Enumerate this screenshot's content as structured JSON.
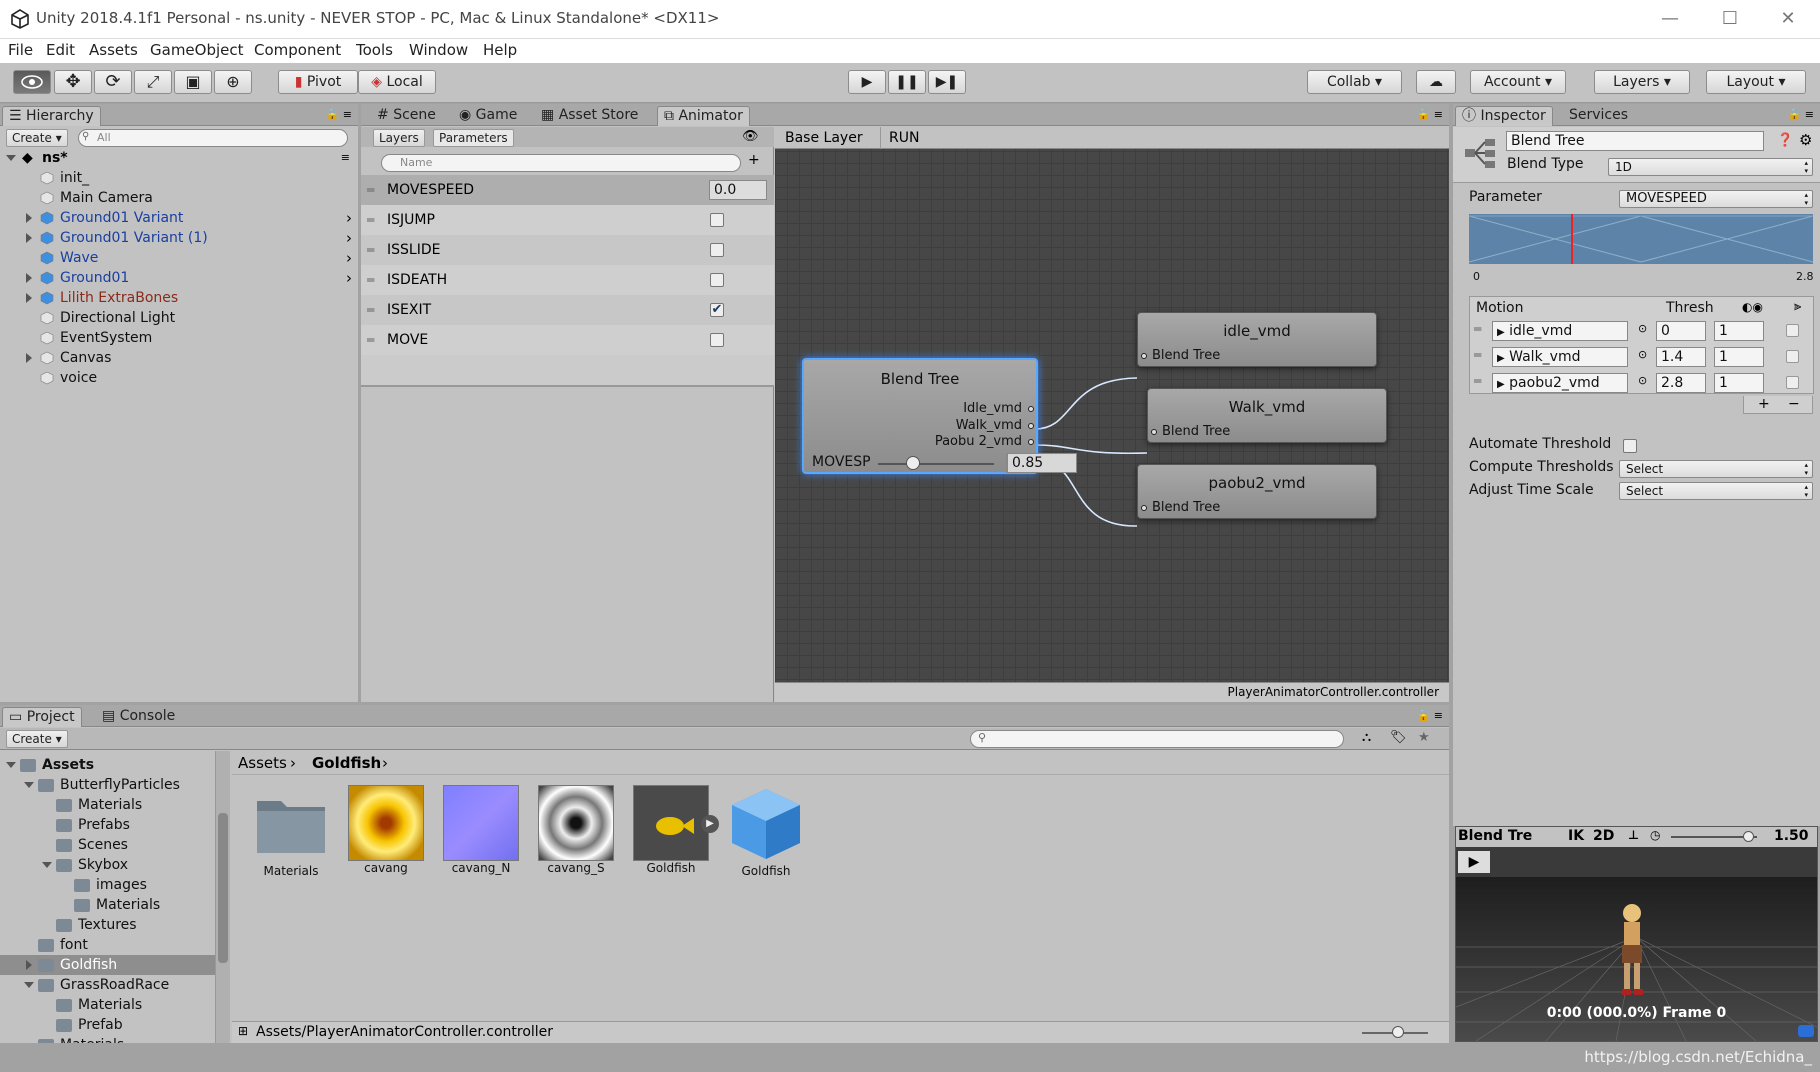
{
  "title": "Unity 2018.4.1f1 Personal - ns.unity - NEVER STOP - PC, Mac & Linux Standalone* <DX11>",
  "window_controls": {
    "minimize": "—",
    "maximize": "☐",
    "close": "✕"
  },
  "menu": [
    "File",
    "Edit",
    "Assets",
    "GameObject",
    "Component",
    "Tools",
    "Window",
    "Help"
  ],
  "toolbar": {
    "pivot": "Pivot",
    "local": "Local",
    "collab": "Collab ▾",
    "account": "Account",
    "layers": "Layers",
    "layout": "Layout"
  },
  "hierarchy": {
    "tab": "Hierarchy",
    "create": "Create ▾",
    "search_placeholder": "All",
    "scene": "ns*",
    "items": [
      {
        "label": "init_",
        "color": "#111"
      },
      {
        "label": "Main Camera",
        "color": "#111"
      },
      {
        "label": "Ground01 Variant",
        "color": "#1a3fa0"
      },
      {
        "label": "Ground01 Variant (1)",
        "color": "#1a3fa0"
      },
      {
        "label": "Wave",
        "color": "#1a3fa0"
      },
      {
        "label": "Ground01",
        "color": "#1a3fa0"
      },
      {
        "label": "Lilith ExtraBones",
        "color": "#8a2a1a"
      },
      {
        "label": "Directional Light",
        "color": "#111"
      },
      {
        "label": "EventSystem",
        "color": "#111"
      },
      {
        "label": "Canvas",
        "color": "#111"
      },
      {
        "label": "voice",
        "color": "#111"
      }
    ]
  },
  "center_tabs": {
    "scene": "Scene",
    "game": "Game",
    "asset_store": "Asset Store",
    "animator": "Animator"
  },
  "animator": {
    "layers_tab": "Layers",
    "parameters_tab": "Parameters",
    "param_search_placeholder": "Name",
    "parameters": [
      {
        "name": "MOVESPEED",
        "value": "0.0"
      },
      {
        "name": "ISJUMP",
        "checked": false
      },
      {
        "name": "ISSLIDE",
        "checked": false
      },
      {
        "name": "ISDEATH",
        "checked": false
      },
      {
        "name": "ISEXIT",
        "checked": true
      },
      {
        "name": "MOVE",
        "checked": false
      }
    ],
    "breadcrumb": [
      "Base Layer",
      "RUN"
    ],
    "blend_node": {
      "title": "Blend Tree",
      "out1": "Idle_vmd",
      "out2": "Walk_vmd",
      "out3": "Paobu 2_vmd",
      "param": "MOVESP",
      "value": "0.85",
      "slider_fraction": 0.3
    },
    "motion_nodes": [
      {
        "title": "idle_vmd",
        "sub": "Blend Tree"
      },
      {
        "title": "Walk_vmd",
        "sub": "Blend Tree"
      },
      {
        "title": "paobu2_vmd",
        "sub": "Blend Tree"
      }
    ],
    "footer": "PlayerAnimatorController.controller"
  },
  "inspector": {
    "tab": "Inspector",
    "services": "Services",
    "name": "Blend Tree",
    "blend_type_label": "Blend Type",
    "blend_type": "1D",
    "parameter_label": "Parameter",
    "parameter": "MOVESPEED",
    "graph_min": "0",
    "graph_max": "2.8",
    "graph_marker_fraction": 0.3,
    "motion_header": "Motion",
    "thresh_header": "Thresh",
    "motions": [
      {
        "name": "idle_vmd",
        "thresh": "0",
        "speed": "1"
      },
      {
        "name": "Walk_vmd",
        "thresh": "1.4",
        "speed": "1"
      },
      {
        "name": "paobu2_vmd",
        "thresh": "2.8",
        "speed": "1"
      }
    ],
    "add": "+",
    "remove": "−",
    "automate_label": "Automate Threshold",
    "compute_label": "Compute Thresholds",
    "compute_value": "Select",
    "adjust_label": "Adjust Time Scale",
    "adjust_value": "Select"
  },
  "preview": {
    "title": "Blend Tre",
    "ik": "IK",
    "twod": "2D",
    "speed": "1.50",
    "time": "0:00 (000.0%) Frame 0",
    "watermark": "https://blog.csdn.net/Echidna_"
  },
  "project": {
    "tab": "Project",
    "console": "Console",
    "create": "Create ▾",
    "tree": [
      {
        "label": "Assets",
        "depth": 0,
        "expanded": true,
        "bold": true
      },
      {
        "label": "ButterflyParticles",
        "depth": 1,
        "expanded": true
      },
      {
        "label": "Materials",
        "depth": 2
      },
      {
        "label": "Prefabs",
        "depth": 2
      },
      {
        "label": "Scenes",
        "depth": 2
      },
      {
        "label": "Skybox",
        "depth": 2,
        "expanded": true
      },
      {
        "label": "images",
        "depth": 3
      },
      {
        "label": "Materials",
        "depth": 3
      },
      {
        "label": "Textures",
        "depth": 2
      },
      {
        "label": "font",
        "depth": 1
      },
      {
        "label": "Goldfish",
        "depth": 1,
        "collapsed": true,
        "selected": true
      },
      {
        "label": "GrassRoadRace",
        "depth": 1,
        "expanded": true
      },
      {
        "label": "Materials",
        "depth": 2
      },
      {
        "label": "Prefab",
        "depth": 2
      },
      {
        "label": "Materials",
        "depth": 1
      }
    ],
    "path": [
      "Assets",
      "Goldfish"
    ],
    "assets": [
      {
        "label": "Materials",
        "kind": "folder"
      },
      {
        "label": "cavang",
        "kind": "tex-gold"
      },
      {
        "label": "cavang_N",
        "kind": "tex-normal"
      },
      {
        "label": "cavang_S",
        "kind": "tex-spec"
      },
      {
        "label": "Goldfish",
        "kind": "model"
      },
      {
        "label": "Goldfish",
        "kind": "cube"
      }
    ],
    "footer": "Assets/PlayerAnimatorController.controller"
  }
}
